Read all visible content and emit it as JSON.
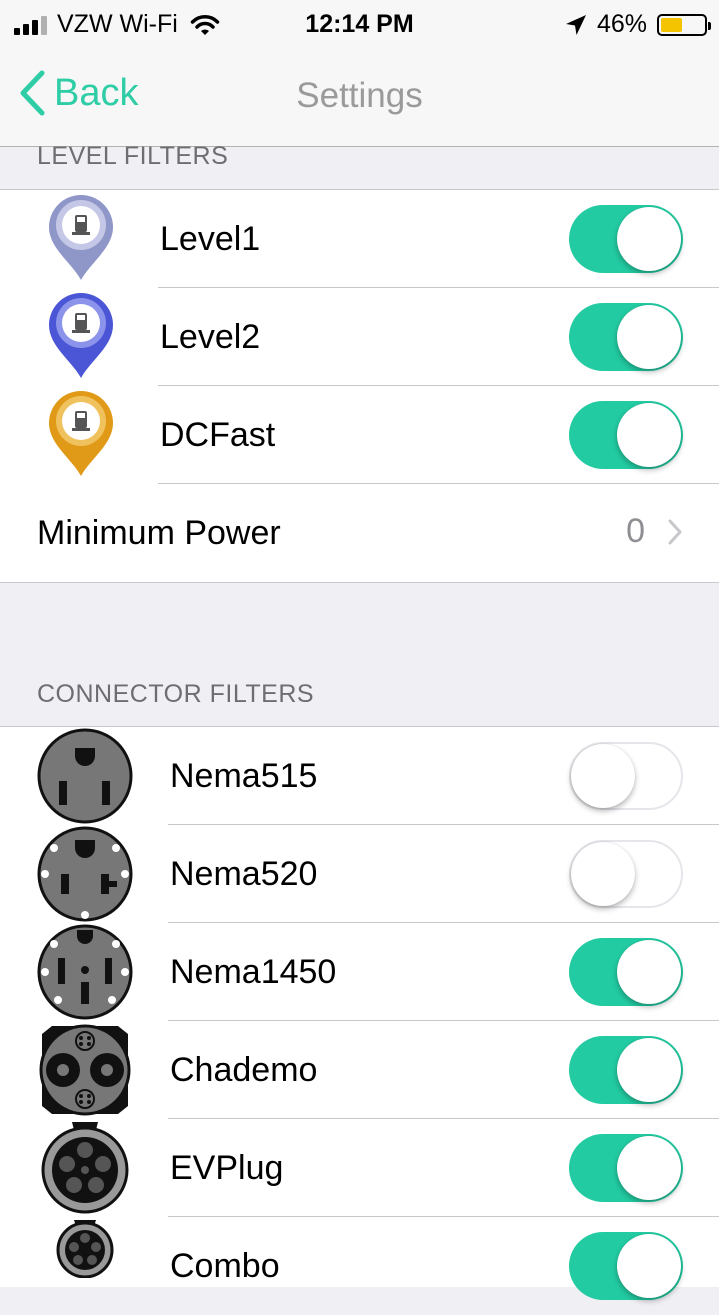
{
  "status_bar": {
    "carrier": "VZW Wi-Fi",
    "time": "12:14 PM",
    "battery": "46%",
    "battery_level": 0.46,
    "icons": [
      "signal-icon",
      "wifi-icon",
      "location-arrow-icon",
      "battery-icon"
    ]
  },
  "nav": {
    "back_label": "Back",
    "title": "Settings"
  },
  "level_filters": {
    "header": "LEVEL FILTERS",
    "items": [
      {
        "label": "Level1",
        "on": true,
        "icon": "level1-pin-icon",
        "color": "#8f97c9"
      },
      {
        "label": "Level2",
        "on": true,
        "icon": "level2-pin-icon",
        "color": "#4a56d6"
      },
      {
        "label": "DCFast",
        "on": true,
        "icon": "dcfast-pin-icon",
        "color": "#e09a18"
      }
    ],
    "minimum_power": {
      "label": "Minimum Power",
      "value": "0"
    }
  },
  "connector_filters": {
    "header": "CONNECTOR FILTERS",
    "items": [
      {
        "label": "Nema515",
        "on": false,
        "icon": "nema515-connector-icon"
      },
      {
        "label": "Nema520",
        "on": false,
        "icon": "nema520-connector-icon"
      },
      {
        "label": "Nema1450",
        "on": true,
        "icon": "nema1450-connector-icon"
      },
      {
        "label": "Chademo",
        "on": true,
        "icon": "chademo-connector-icon"
      },
      {
        "label": "EVPlug",
        "on": true,
        "icon": "evplug-connector-icon"
      },
      {
        "label": "Combo",
        "on": true,
        "icon": "combo-connector-icon"
      }
    ]
  },
  "colors": {
    "accent": "#22cba2",
    "back_text": "#2ecda6",
    "switch_off_border": "#e5e5ea",
    "section_background": "#efeff4"
  }
}
